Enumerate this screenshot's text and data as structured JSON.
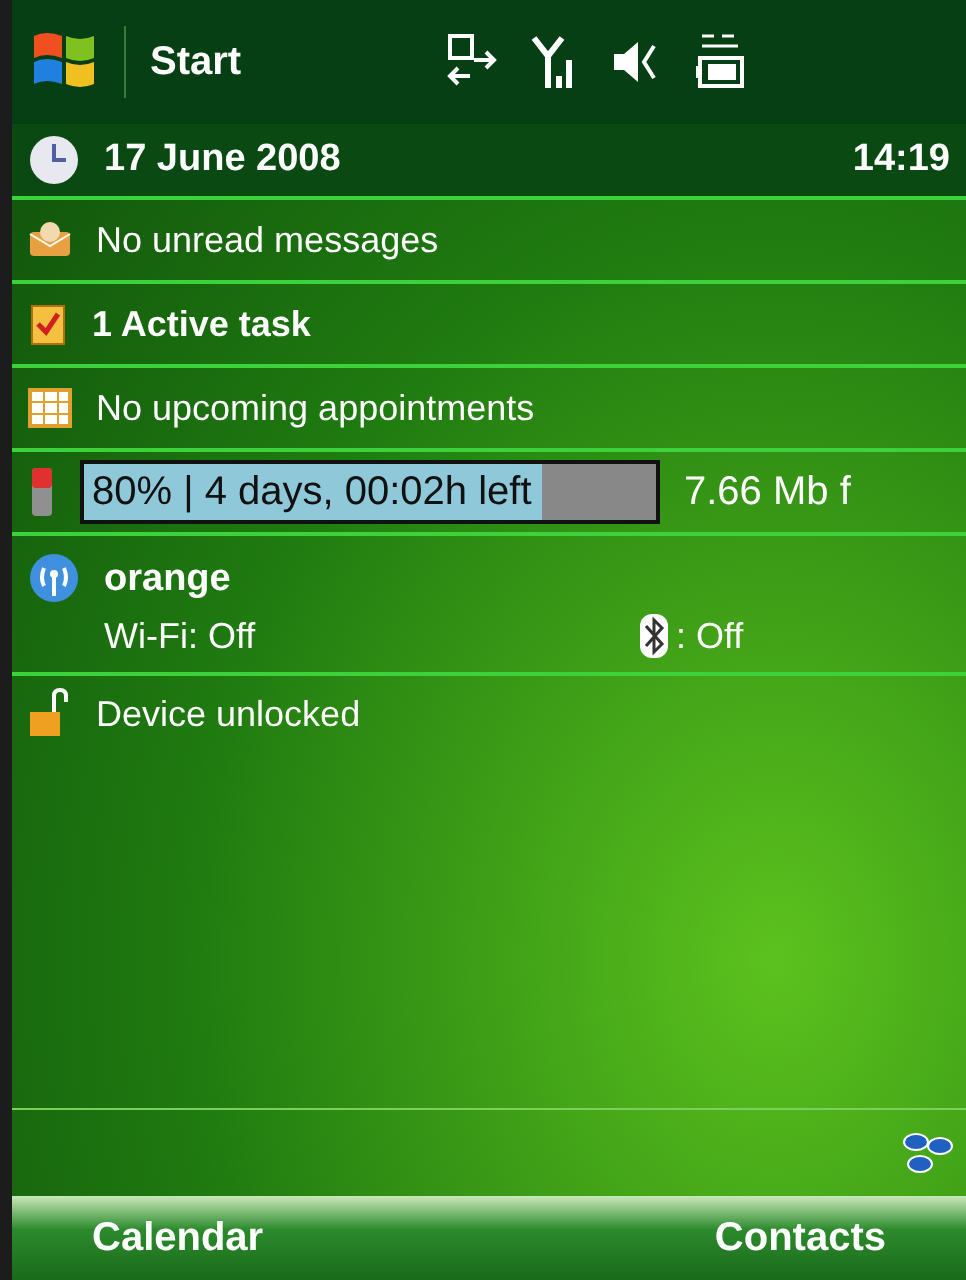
{
  "title_bar": {
    "title": "Start"
  },
  "today": {
    "date": "17 June 2008",
    "time": "14:19"
  },
  "items": [
    {
      "kind": "messages",
      "text": "No unread messages",
      "bold": false
    },
    {
      "kind": "tasks",
      "text": "1 Active task",
      "bold": true
    },
    {
      "kind": "calendar",
      "text": "No upcoming appointments",
      "bold": false
    }
  ],
  "battery": {
    "level": 0.8,
    "text": "80% | 4 days, 00:02h left",
    "memory": "7.66 Mb f"
  },
  "connectivity": {
    "operator": "orange",
    "wifi": "Wi-Fi: Off",
    "bluetooth": ": Off"
  },
  "lock": {
    "text": "Device unlocked"
  },
  "softkeys": [
    "Calendar",
    "Contacts"
  ]
}
